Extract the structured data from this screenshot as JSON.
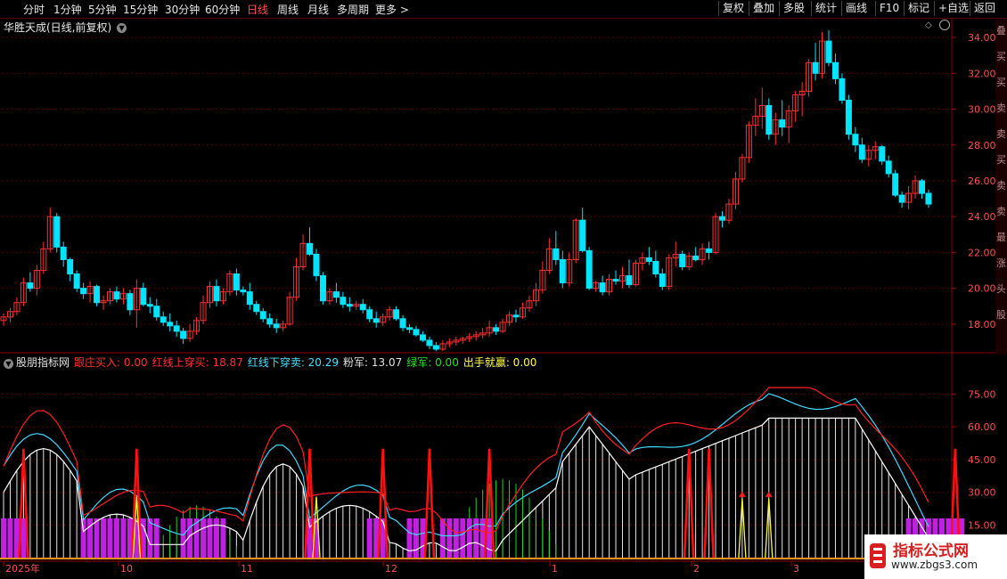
{
  "toolbar": {
    "periods": [
      "分时",
      "1分钟",
      "5分钟",
      "15分钟",
      "30分钟",
      "60分钟",
      "日线",
      "周线",
      "月线",
      "多周期",
      "更多 >"
    ],
    "active": "日线",
    "right": [
      "复权",
      "叠加",
      "多股",
      "统计",
      "画线",
      "F10",
      "标记",
      "+自选",
      "返回"
    ]
  },
  "chart_title": "华胜天成(日线,前复权)",
  "indicator": {
    "name": "股朋指标网",
    "labels": [
      {
        "text": "跟庄买入: 0.00",
        "color": "#ff3030"
      },
      {
        "text": "红线上穿买: 18.87",
        "color": "#ff3030"
      },
      {
        "text": "红线下穿卖: 20.29",
        "color": "#40e0ff"
      },
      {
        "text": "粉军: 13.07",
        "color": "#e0e0e0"
      },
      {
        "text": "绿军: 0.00",
        "color": "#20e020"
      },
      {
        "text": "出手就赢: 0.00",
        "color": "#ffff40"
      }
    ]
  },
  "price_axis": [
    "34.00",
    "32.00",
    "30.00",
    "28.00",
    "26.00",
    "24.00",
    "22.00",
    "20.00",
    "18.00"
  ],
  "ind_axis": [
    "75.00",
    "60.00",
    "45.00",
    "30.00",
    "15.00"
  ],
  "date_axis": [
    "2025年",
    "10",
    "11",
    "12",
    "1",
    "2",
    "3"
  ],
  "side_chars": [
    "叠",
    "买",
    "买",
    "卖",
    "卖",
    "买",
    "卖",
    "卖",
    "最",
    "涨",
    "头",
    "股"
  ],
  "watermark": {
    "line1": "指标公式网",
    "line2": "www.zbgs3.com"
  },
  "colors": {
    "up": "#ff3030",
    "down": "#00e5ff",
    "bg": "#000000",
    "grid": "#5a0000"
  },
  "chart_data": {
    "type": "candlestick",
    "ylim": [
      16.4,
      35.0
    ],
    "candles": [
      [
        18.2,
        18.6,
        17.9,
        18.4
      ],
      [
        18.4,
        18.9,
        18.1,
        18.7
      ],
      [
        18.7,
        19.5,
        18.5,
        19.2
      ],
      [
        19.2,
        20.6,
        19.0,
        20.3
      ],
      [
        20.3,
        20.9,
        19.8,
        20.0
      ],
      [
        20.0,
        21.3,
        19.6,
        21.0
      ],
      [
        21.0,
        22.6,
        20.8,
        22.2
      ],
      [
        22.2,
        24.5,
        22.0,
        24.0
      ],
      [
        24.0,
        24.2,
        22.0,
        22.3
      ],
      [
        22.3,
        22.6,
        21.2,
        21.6
      ],
      [
        21.6,
        21.7,
        20.4,
        20.8
      ],
      [
        20.8,
        21.0,
        19.8,
        20.0
      ],
      [
        20.0,
        20.3,
        19.4,
        19.7
      ],
      [
        19.7,
        20.4,
        19.2,
        20.1
      ],
      [
        20.1,
        20.2,
        19.0,
        19.2
      ],
      [
        19.2,
        19.6,
        18.8,
        19.3
      ],
      [
        19.3,
        20.0,
        19.1,
        19.8
      ],
      [
        19.8,
        20.1,
        19.2,
        19.4
      ],
      [
        19.4,
        20.0,
        19.1,
        19.7
      ],
      [
        19.7,
        19.9,
        18.5,
        18.8
      ],
      [
        18.8,
        20.5,
        17.8,
        20.0
      ],
      [
        20.0,
        20.3,
        19.0,
        19.1
      ],
      [
        19.1,
        19.5,
        18.6,
        19.0
      ],
      [
        19.0,
        19.4,
        18.2,
        18.4
      ],
      [
        18.4,
        18.7,
        17.9,
        18.1
      ],
      [
        18.1,
        18.6,
        17.6,
        17.9
      ],
      [
        17.9,
        18.2,
        17.3,
        17.6
      ],
      [
        17.6,
        17.8,
        16.9,
        17.2
      ],
      [
        17.2,
        18.0,
        17.0,
        17.6
      ],
      [
        17.6,
        18.4,
        17.4,
        18.2
      ],
      [
        18.2,
        19.6,
        18.0,
        19.2
      ],
      [
        19.2,
        20.4,
        18.9,
        20.1
      ],
      [
        20.1,
        20.5,
        19.0,
        19.3
      ],
      [
        19.3,
        20.0,
        19.1,
        19.8
      ],
      [
        19.8,
        21.0,
        19.6,
        20.8
      ],
      [
        20.8,
        21.1,
        19.6,
        19.9
      ],
      [
        19.9,
        20.1,
        19.6,
        19.8
      ],
      [
        19.8,
        20.3,
        18.8,
        19.1
      ],
      [
        19.1,
        19.3,
        18.5,
        18.7
      ],
      [
        18.7,
        18.9,
        18.1,
        18.3
      ],
      [
        18.3,
        18.6,
        17.8,
        18.0
      ],
      [
        18.0,
        18.3,
        17.5,
        17.8
      ],
      [
        17.8,
        18.2,
        17.6,
        18.0
      ],
      [
        18.0,
        19.8,
        17.9,
        19.5
      ],
      [
        19.5,
        21.7,
        19.3,
        21.2
      ],
      [
        21.2,
        23.0,
        21.0,
        22.5
      ],
      [
        22.5,
        23.4,
        21.8,
        21.9
      ],
      [
        21.9,
        22.2,
        20.4,
        20.7
      ],
      [
        20.7,
        20.9,
        19.1,
        19.3
      ],
      [
        19.3,
        20.0,
        19.1,
        19.8
      ],
      [
        19.8,
        20.3,
        19.2,
        19.5
      ],
      [
        19.5,
        19.8,
        18.9,
        19.1
      ],
      [
        19.1,
        19.5,
        18.7,
        19.0
      ],
      [
        19.0,
        19.3,
        18.8,
        19.1
      ],
      [
        19.1,
        19.4,
        18.6,
        18.8
      ],
      [
        18.8,
        19.0,
        18.1,
        18.3
      ],
      [
        18.3,
        18.7,
        17.8,
        18.1
      ],
      [
        18.1,
        18.6,
        17.9,
        18.4
      ],
      [
        18.4,
        19.0,
        18.2,
        18.8
      ],
      [
        18.8,
        19.0,
        18.2,
        18.3
      ],
      [
        18.3,
        18.5,
        17.6,
        17.8
      ],
      [
        17.8,
        18.0,
        17.5,
        17.7
      ],
      [
        17.7,
        17.9,
        17.3,
        17.4
      ],
      [
        17.4,
        17.6,
        17.0,
        17.1
      ],
      [
        17.1,
        17.3,
        16.6,
        16.8
      ],
      [
        16.8,
        17.0,
        16.5,
        16.6
      ],
      [
        16.6,
        17.1,
        16.5,
        16.9
      ],
      [
        16.9,
        17.2,
        16.7,
        17.0
      ],
      [
        17.0,
        17.3,
        16.8,
        17.1
      ],
      [
        17.1,
        17.3,
        16.9,
        17.2
      ],
      [
        17.2,
        17.5,
        17.0,
        17.3
      ],
      [
        17.3,
        17.6,
        17.1,
        17.4
      ],
      [
        17.4,
        17.8,
        17.2,
        17.5
      ],
      [
        17.5,
        18.2,
        17.3,
        17.8
      ],
      [
        17.8,
        18.0,
        17.4,
        17.6
      ],
      [
        17.6,
        18.3,
        17.5,
        18.1
      ],
      [
        18.1,
        18.7,
        17.9,
        18.5
      ],
      [
        18.5,
        18.8,
        18.1,
        18.4
      ],
      [
        18.4,
        19.2,
        18.3,
        18.9
      ],
      [
        18.9,
        19.6,
        18.7,
        19.3
      ],
      [
        19.3,
        20.3,
        19.0,
        19.9
      ],
      [
        19.9,
        21.5,
        19.7,
        21.0
      ],
      [
        21.0,
        22.8,
        20.8,
        22.2
      ],
      [
        22.2,
        23.2,
        21.3,
        21.6
      ],
      [
        21.6,
        22.1,
        20.0,
        20.3
      ],
      [
        20.3,
        22.0,
        20.1,
        21.6
      ],
      [
        21.6,
        23.9,
        21.4,
        23.8
      ],
      [
        23.8,
        24.5,
        22.0,
        22.1
      ],
      [
        22.1,
        22.3,
        19.9,
        20.0
      ],
      [
        20.0,
        20.4,
        19.8,
        20.3
      ],
      [
        20.3,
        20.7,
        19.6,
        19.8
      ],
      [
        19.8,
        20.8,
        19.6,
        20.5
      ],
      [
        20.5,
        21.0,
        20.2,
        20.4
      ],
      [
        20.4,
        21.2,
        20.0,
        20.7
      ],
      [
        20.7,
        21.6,
        20.0,
        20.2
      ],
      [
        20.2,
        21.6,
        20.1,
        21.4
      ],
      [
        21.4,
        22.0,
        21.0,
        21.7
      ],
      [
        21.7,
        22.3,
        21.3,
        21.5
      ],
      [
        21.5,
        22.1,
        20.6,
        20.8
      ],
      [
        20.8,
        21.1,
        19.9,
        20.1
      ],
      [
        20.1,
        21.9,
        19.9,
        21.7
      ],
      [
        21.7,
        22.6,
        21.2,
        21.9
      ],
      [
        21.9,
        22.1,
        21.0,
        21.2
      ],
      [
        21.2,
        22.0,
        21.0,
        21.8
      ],
      [
        21.8,
        22.3,
        21.5,
        21.6
      ],
      [
        21.6,
        22.5,
        21.3,
        22.2
      ],
      [
        22.2,
        22.6,
        21.6,
        22.0
      ],
      [
        22.0,
        24.2,
        21.9,
        24.0
      ],
      [
        24.0,
        24.3,
        23.4,
        23.8
      ],
      [
        23.8,
        25.0,
        23.6,
        24.7
      ],
      [
        24.7,
        26.5,
        24.4,
        26.1
      ],
      [
        26.1,
        27.5,
        25.9,
        27.3
      ],
      [
        27.3,
        29.3,
        27.0,
        29.1
      ],
      [
        29.1,
        30.6,
        28.5,
        29.6
      ],
      [
        29.6,
        31.2,
        28.9,
        30.2
      ],
      [
        30.2,
        30.6,
        28.3,
        28.6
      ],
      [
        28.6,
        29.8,
        28.0,
        29.4
      ],
      [
        29.4,
        30.5,
        28.5,
        29.0
      ],
      [
        29.0,
        30.2,
        28.1,
        29.9
      ],
      [
        29.9,
        31.0,
        29.3,
        30.8
      ],
      [
        30.8,
        31.5,
        29.6,
        31.0
      ],
      [
        31.0,
        32.8,
        30.7,
        32.6
      ],
      [
        32.6,
        33.7,
        31.6,
        32.0
      ],
      [
        32.0,
        34.3,
        31.7,
        33.8
      ],
      [
        33.8,
        34.4,
        32.4,
        32.6
      ],
      [
        32.6,
        33.1,
        31.4,
        31.7
      ],
      [
        31.7,
        32.0,
        30.3,
        30.5
      ],
      [
        30.5,
        30.8,
        28.3,
        28.6
      ],
      [
        28.6,
        29.0,
        27.6,
        28.0
      ],
      [
        28.0,
        28.4,
        27.0,
        27.2
      ],
      [
        27.2,
        28.0,
        26.8,
        27.7
      ],
      [
        27.7,
        28.2,
        27.2,
        27.9
      ],
      [
        27.9,
        28.0,
        26.9,
        27.1
      ],
      [
        27.1,
        27.4,
        26.2,
        26.4
      ],
      [
        26.4,
        26.6,
        25.1,
        25.2
      ],
      [
        25.2,
        25.4,
        24.5,
        24.8
      ],
      [
        24.8,
        25.7,
        24.4,
        25.3
      ],
      [
        25.3,
        26.3,
        25.0,
        26.0
      ],
      [
        26.0,
        26.1,
        25.0,
        25.3
      ],
      [
        25.3,
        25.5,
        24.5,
        24.7
      ]
    ]
  }
}
